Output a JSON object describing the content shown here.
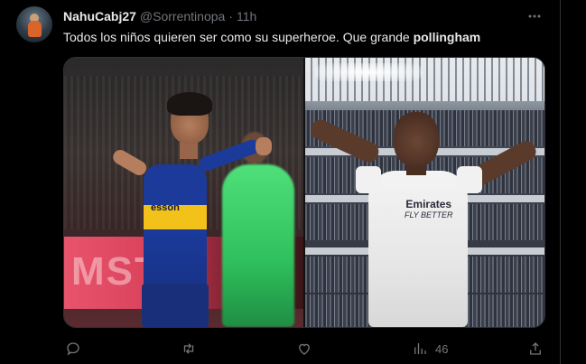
{
  "tweet": {
    "author": {
      "display_name": "NahuCabj27",
      "handle": "@Sorrentinopa",
      "separator": "·",
      "time": "11h"
    },
    "text_prefix": "Todos los niños quieren ser como su superheroe. Que grande ",
    "text_bold": "pollingham",
    "media": {
      "left_jersey_sponsor": "esson",
      "right_jersey_sponsor": "Emirates",
      "right_jersey_tagline": "FLY BETTER",
      "left_ad_board": "MST"
    },
    "actions": {
      "reply_count": "",
      "retweet_count": "",
      "like_count": "",
      "views_count": "46"
    },
    "icons": {
      "more": "more-horizontal-icon",
      "reply": "reply-icon",
      "retweet": "retweet-icon",
      "like": "heart-icon",
      "views": "views-chart-icon",
      "share": "share-icon"
    }
  },
  "colors": {
    "background": "#000000",
    "primary_text": "#e7e9ea",
    "secondary_text": "#71767b",
    "border": "#2f3336"
  }
}
